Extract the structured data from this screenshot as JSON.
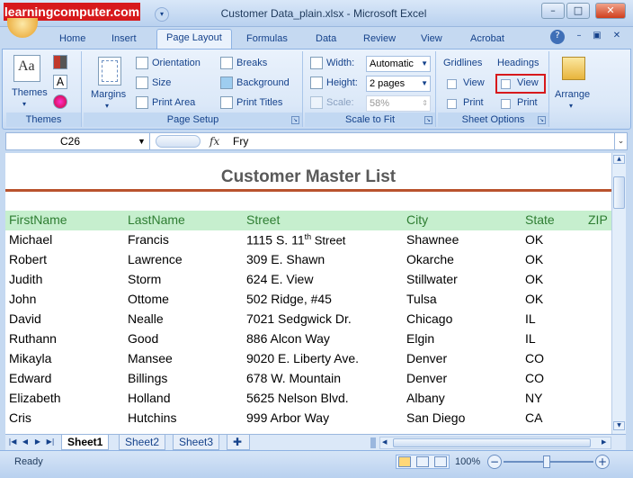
{
  "watermark": "learningcomputer.com",
  "window": {
    "title": "Customer Data_plain.xlsx - Microsoft Excel",
    "minimize": "–",
    "maximize": "□",
    "close": "✕",
    "qat_dropdown": "▾"
  },
  "tabs": [
    "Home",
    "Insert",
    "Page Layout",
    "Formulas",
    "Data",
    "Review",
    "View",
    "Acrobat"
  ],
  "active_tab": "Page Layout",
  "tab_controls": {
    "help": "?",
    "restore": "–",
    "window": "▣",
    "close": "✕"
  },
  "ribbon": {
    "themes": {
      "label": "Themes",
      "button": "Themes",
      "colors_icon": "colors-icon",
      "fonts_icon": "A",
      "effects_icon": "effects-icon"
    },
    "page_setup": {
      "label": "Page Setup",
      "margins": "Margins",
      "orientation": "Orientation",
      "size": "Size",
      "print_area": "Print Area",
      "breaks": "Breaks",
      "background": "Background",
      "print_titles": "Print Titles"
    },
    "scale_to_fit": {
      "label": "Scale to Fit",
      "width_label": "Width:",
      "width_value": "Automatic",
      "height_label": "Height:",
      "height_value": "2 pages",
      "scale_label": "Scale:",
      "scale_value": "58%"
    },
    "sheet_options": {
      "label": "Sheet Options",
      "gridlines": "Gridlines",
      "headings": "Headings",
      "gridlines_view": "View",
      "gridlines_print": "Print",
      "headings_view": "View",
      "headings_print": "Print"
    },
    "arrange": {
      "label": "Arrange"
    }
  },
  "formula_bar": {
    "name_box": "C26",
    "fx": "fx",
    "value": "Fry"
  },
  "sheet": {
    "title": "Customer Master List",
    "headers": [
      "FirstName",
      "LastName",
      "Street",
      "City",
      "State",
      "ZIP"
    ],
    "rows": [
      [
        "Michael",
        "Francis",
        "1115 S. 11",
        "Shawnee",
        "OK"
      ],
      [
        "Robert",
        "Lawrence",
        "309 E. Shawn",
        "Okarche",
        "OK"
      ],
      [
        "Judith",
        "Storm",
        "624 E. View",
        "Stillwater",
        "OK"
      ],
      [
        "John",
        "Ottome",
        "502 Ridge, #45",
        "Tulsa",
        "OK"
      ],
      [
        "David",
        "Nealle",
        "7021 Sedgwick Dr.",
        "Chicago",
        "IL"
      ],
      [
        "Ruthann",
        "Good",
        "886 Alcon Way",
        "Elgin",
        "IL"
      ],
      [
        "Mikayla",
        "Mansee",
        "9020 E. Liberty Ave.",
        "Denver",
        "CO"
      ],
      [
        "Edward",
        "Billings",
        "678 W. Mountain",
        "Denver",
        "CO"
      ],
      [
        "Elizabeth",
        "Holland",
        "5625 Nelson Blvd.",
        "Albany",
        "NY"
      ],
      [
        "Cris",
        "Hutchins",
        "999 Arbor Way",
        "San Diego",
        "CA"
      ]
    ],
    "superscript": "th",
    "street_suffix": " Street"
  },
  "sheet_tabs": [
    "Sheet1",
    "Sheet2",
    "Sheet3"
  ],
  "active_sheet": "Sheet1",
  "status": {
    "ready": "Ready",
    "zoom": "100%"
  }
}
